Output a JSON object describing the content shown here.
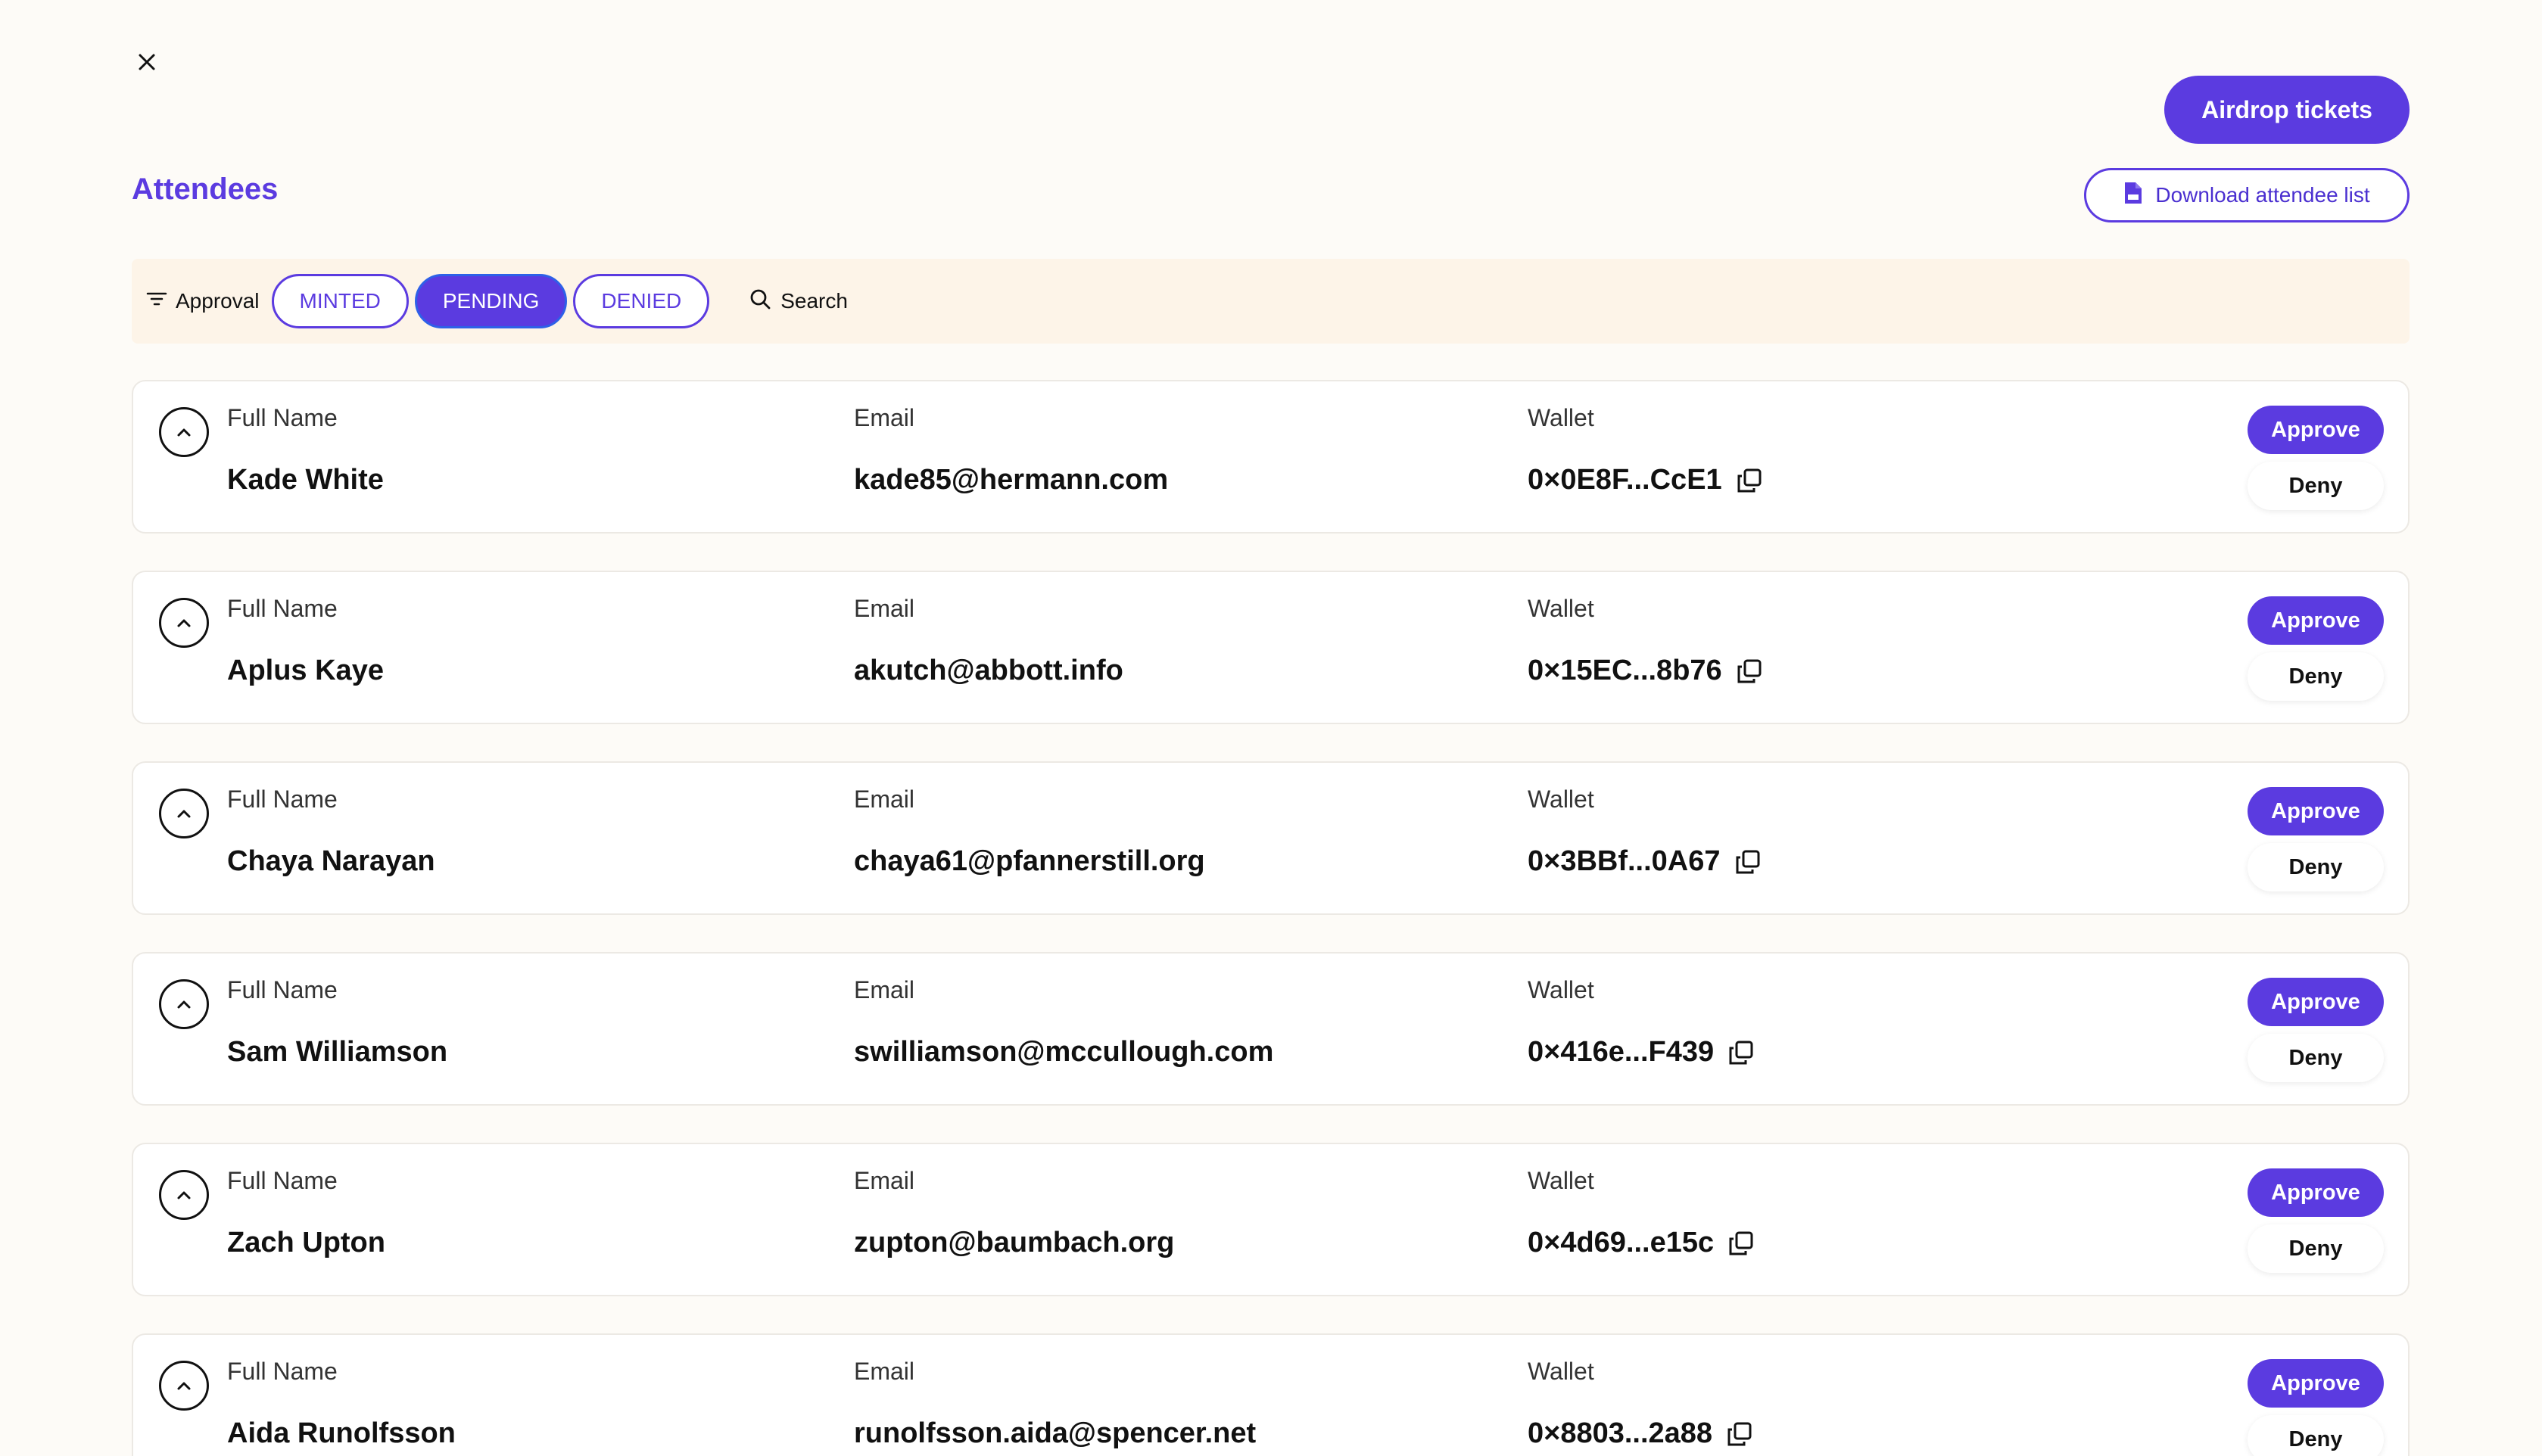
{
  "header": {
    "title": "Attendees",
    "airdrop_label": "Airdrop tickets",
    "download_label": "Download attendee list"
  },
  "filters": {
    "label": "Approval",
    "options": [
      "MINTED",
      "PENDING",
      "DENIED"
    ],
    "active": "PENDING",
    "search_label": "Search"
  },
  "columns": {
    "name": "Full Name",
    "email": "Email",
    "wallet": "Wallet"
  },
  "actions": {
    "approve": "Approve",
    "deny": "Deny"
  },
  "attendees": [
    {
      "name": "Kade White",
      "email": "kade85@hermann.com",
      "wallet": "0×0E8F...CcE1"
    },
    {
      "name": "Aplus Kaye",
      "email": "akutch@abbott.info",
      "wallet": "0×15EC...8b76"
    },
    {
      "name": "Chaya Narayan",
      "email": "chaya61@pfannerstill.org",
      "wallet": "0×3BBf...0A67"
    },
    {
      "name": "Sam Williamson",
      "email": "swilliamson@mccullough.com",
      "wallet": "0×416e...F439"
    },
    {
      "name": "Zach Upton",
      "email": "zupton@baumbach.org",
      "wallet": "0×4d69...e15c"
    },
    {
      "name": "Aida Runolfsson",
      "email": "runolfsson.aida@spencer.net",
      "wallet": "0×8803...2a88"
    }
  ],
  "colors": {
    "accent": "#5b3be0",
    "background": "#fdfbf7",
    "filter_bar": "#fdf4e8"
  }
}
